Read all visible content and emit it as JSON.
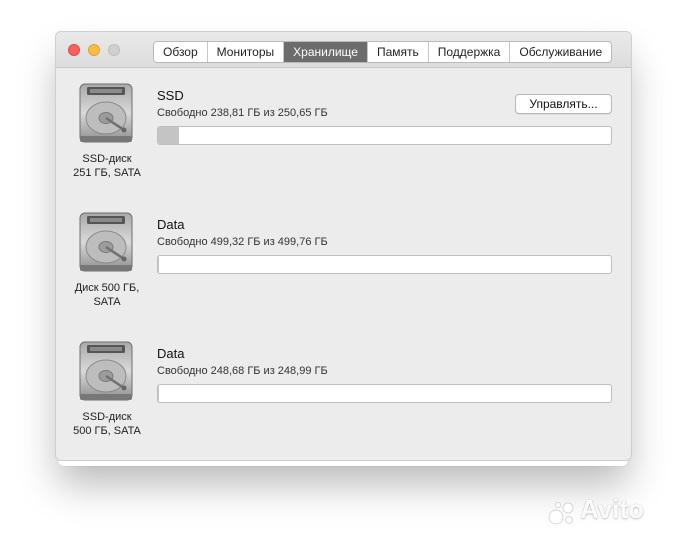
{
  "window": {
    "tabs": [
      {
        "label": "Обзор",
        "active": false
      },
      {
        "label": "Мониторы",
        "active": false
      },
      {
        "label": "Хранилище",
        "active": true
      },
      {
        "label": "Память",
        "active": false
      },
      {
        "label": "Поддержка",
        "active": false
      },
      {
        "label": "Обслуживание",
        "active": false
      }
    ],
    "manage_label": "Управлять..."
  },
  "disks": [
    {
      "name": "SSD",
      "free_text": "Свободно 238,81 ГБ из 250,65 ГБ",
      "caption_line1": "SSD-диск",
      "caption_line2": "251 ГБ, SATA",
      "used_fraction": 0.047,
      "icon": "hard-drive-icon"
    },
    {
      "name": "Data",
      "free_text": "Свободно 499,32 ГБ из 499,76 ГБ",
      "caption_line1": "Диск 500 ГБ,",
      "caption_line2": "SATA",
      "used_fraction": 0.001,
      "icon": "hard-drive-icon"
    },
    {
      "name": "Data",
      "free_text": "Свободно 248,68 ГБ из 248,99 ГБ",
      "caption_line1": "SSD-диск",
      "caption_line2": "500 ГБ, SATA",
      "used_fraction": 0.001,
      "icon": "hard-drive-icon"
    }
  ],
  "watermark": {
    "text": "Avito"
  },
  "colors": {
    "active_tab": "#6c6c6c",
    "bar_fill": "#c4c4c4",
    "close": "#fc605c",
    "minimize": "#fdbc40",
    "zoom_inactive": "#cfcfcf"
  }
}
